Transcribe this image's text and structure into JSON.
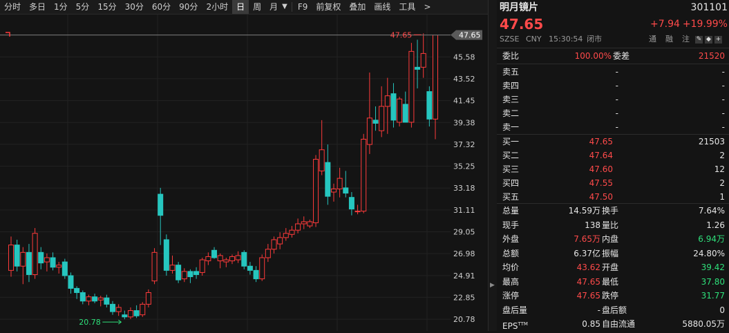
{
  "toolbar": {
    "items": [
      "分时",
      "多日",
      "1分",
      "5分",
      "15分",
      "30分",
      "60分",
      "90分",
      "2小时",
      "日",
      "周",
      "月"
    ],
    "active_index": 9,
    "f9": "F9",
    "restore": "前复权",
    "overlay": "叠加",
    "draw": "画线",
    "tools": "工具",
    "more": ">"
  },
  "chart_data": {
    "type": "candlestick",
    "ylim": [
      20.2,
      48.8
    ],
    "y_ticks": [
      "47.65",
      "45.58",
      "43.52",
      "41.45",
      "39.38",
      "37.32",
      "35.25",
      "33.18",
      "31.11",
      "29.05",
      "26.98",
      "24.91",
      "22.85",
      "20.78"
    ],
    "current_price_label": "47.65",
    "high_annotation": "47.65",
    "low_annotation": "20.78",
    "candles": [
      {
        "o": 25.4,
        "h": 28.6,
        "l": 24.8,
        "c": 27.8
      },
      {
        "o": 27.8,
        "h": 28.3,
        "l": 25.3,
        "c": 25.8
      },
      {
        "o": 25.8,
        "h": 27.6,
        "l": 24.1,
        "c": 27.1
      },
      {
        "o": 27.1,
        "h": 27.9,
        "l": 24.3,
        "c": 25.0
      },
      {
        "o": 25.0,
        "h": 29.4,
        "l": 24.6,
        "c": 28.9
      },
      {
        "o": 27.1,
        "h": 27.6,
        "l": 25.5,
        "c": 26.1
      },
      {
        "o": 26.2,
        "h": 27.0,
        "l": 25.3,
        "c": 26.6
      },
      {
        "o": 26.6,
        "h": 27.1,
        "l": 25.4,
        "c": 25.7
      },
      {
        "o": 25.7,
        "h": 26.2,
        "l": 25.1,
        "c": 25.9
      },
      {
        "o": 26.2,
        "h": 26.5,
        "l": 24.6,
        "c": 24.9
      },
      {
        "o": 24.9,
        "h": 25.2,
        "l": 23.2,
        "c": 23.7
      },
      {
        "o": 23.7,
        "h": 23.9,
        "l": 22.7,
        "c": 23.3
      },
      {
        "o": 23.3,
        "h": 23.5,
        "l": 22.2,
        "c": 22.5
      },
      {
        "o": 22.5,
        "h": 23.1,
        "l": 22.1,
        "c": 22.9
      },
      {
        "o": 22.9,
        "h": 23.2,
        "l": 22.3,
        "c": 22.5
      },
      {
        "o": 22.6,
        "h": 23.0,
        "l": 22.0,
        "c": 22.8
      },
      {
        "o": 22.8,
        "h": 23.1,
        "l": 21.9,
        "c": 22.2
      },
      {
        "o": 22.2,
        "h": 22.5,
        "l": 21.2,
        "c": 21.5
      },
      {
        "o": 21.5,
        "h": 22.2,
        "l": 21.1,
        "c": 21.9
      },
      {
        "o": 21.2,
        "h": 21.6,
        "l": 20.78,
        "c": 21.0
      },
      {
        "o": 21.0,
        "h": 21.9,
        "l": 20.8,
        "c": 21.6
      },
      {
        "o": 21.6,
        "h": 22.1,
        "l": 20.9,
        "c": 21.1
      },
      {
        "o": 21.2,
        "h": 22.4,
        "l": 21.0,
        "c": 22.2
      },
      {
        "o": 22.2,
        "h": 23.6,
        "l": 21.9,
        "c": 23.3
      },
      {
        "o": 24.4,
        "h": 27.5,
        "l": 24.1,
        "c": 27.1
      },
      {
        "o": 32.6,
        "h": 33.2,
        "l": 27.8,
        "c": 30.6
      },
      {
        "o": 28.3,
        "h": 28.8,
        "l": 24.9,
        "c": 25.4
      },
      {
        "o": 25.4,
        "h": 26.8,
        "l": 25.1,
        "c": 25.9
      },
      {
        "o": 25.9,
        "h": 26.2,
        "l": 24.2,
        "c": 24.5
      },
      {
        "o": 24.6,
        "h": 25.6,
        "l": 24.3,
        "c": 25.3
      },
      {
        "o": 25.3,
        "h": 25.5,
        "l": 24.2,
        "c": 24.8
      },
      {
        "o": 25.3,
        "h": 25.7,
        "l": 24.6,
        "c": 25.0
      },
      {
        "o": 25.2,
        "h": 26.6,
        "l": 24.9,
        "c": 26.4
      },
      {
        "o": 26.3,
        "h": 27.1,
        "l": 25.9,
        "c": 26.7
      },
      {
        "o": 27.3,
        "h": 27.6,
        "l": 26.5,
        "c": 26.6
      },
      {
        "o": 26.3,
        "h": 27.0,
        "l": 25.6,
        "c": 26.8
      },
      {
        "o": 26.2,
        "h": 26.6,
        "l": 25.7,
        "c": 26.4
      },
      {
        "o": 26.3,
        "h": 26.9,
        "l": 26.0,
        "c": 26.7
      },
      {
        "o": 26.4,
        "h": 27.2,
        "l": 26.1,
        "c": 26.8
      },
      {
        "o": 27.1,
        "h": 27.3,
        "l": 25.5,
        "c": 25.8
      },
      {
        "o": 25.8,
        "h": 26.2,
        "l": 25.0,
        "c": 25.4
      },
      {
        "o": 25.4,
        "h": 25.8,
        "l": 24.3,
        "c": 24.6
      },
      {
        "o": 24.6,
        "h": 26.9,
        "l": 24.4,
        "c": 26.6
      },
      {
        "o": 26.6,
        "h": 27.9,
        "l": 26.2,
        "c": 27.4
      },
      {
        "o": 27.4,
        "h": 28.6,
        "l": 27.0,
        "c": 28.3
      },
      {
        "o": 27.9,
        "h": 29.0,
        "l": 27.4,
        "c": 28.5
      },
      {
        "o": 28.5,
        "h": 29.4,
        "l": 28.2,
        "c": 28.9
      },
      {
        "o": 28.8,
        "h": 29.6,
        "l": 28.5,
        "c": 29.2
      },
      {
        "o": 29.2,
        "h": 30.3,
        "l": 28.9,
        "c": 29.8
      },
      {
        "o": 29.8,
        "h": 30.5,
        "l": 29.3,
        "c": 30.0
      },
      {
        "o": 29.6,
        "h": 30.2,
        "l": 29.4,
        "c": 30.0
      },
      {
        "o": 29.9,
        "h": 36.3,
        "l": 29.5,
        "c": 35.9
      },
      {
        "o": 34.8,
        "h": 39.6,
        "l": 34.4,
        "c": 36.8
      },
      {
        "o": 35.6,
        "h": 37.3,
        "l": 31.6,
        "c": 32.4
      },
      {
        "o": 32.8,
        "h": 33.6,
        "l": 31.9,
        "c": 33.1
      },
      {
        "o": 33.1,
        "h": 35.1,
        "l": 32.3,
        "c": 34.1
      },
      {
        "o": 33.2,
        "h": 34.8,
        "l": 32.3,
        "c": 32.7
      },
      {
        "o": 32.3,
        "h": 32.8,
        "l": 30.6,
        "c": 31.2
      },
      {
        "o": 31.0,
        "h": 31.6,
        "l": 30.7,
        "c": 31.0
      },
      {
        "o": 31.0,
        "h": 38.3,
        "l": 30.8,
        "c": 37.8
      },
      {
        "o": 37.3,
        "h": 44.1,
        "l": 36.4,
        "c": 39.8
      },
      {
        "o": 39.6,
        "h": 40.9,
        "l": 38.6,
        "c": 39.3
      },
      {
        "o": 38.6,
        "h": 42.8,
        "l": 38.0,
        "c": 40.9
      },
      {
        "o": 40.9,
        "h": 43.6,
        "l": 38.3,
        "c": 41.9
      },
      {
        "o": 42.1,
        "h": 43.1,
        "l": 38.9,
        "c": 39.6
      },
      {
        "o": 39.4,
        "h": 41.8,
        "l": 39.0,
        "c": 41.6
      },
      {
        "o": 41.1,
        "h": 42.3,
        "l": 39.6,
        "c": 39.4
      },
      {
        "o": 39.4,
        "h": 46.9,
        "l": 38.9,
        "c": 46.1
      },
      {
        "o": 44.6,
        "h": 47.2,
        "l": 42.6,
        "c": 44.4
      },
      {
        "o": 44.6,
        "h": 47.8,
        "l": 43.6,
        "c": 45.9
      },
      {
        "o": 42.3,
        "h": 42.8,
        "l": 39.0,
        "c": 39.7
      },
      {
        "o": 39.7,
        "h": 47.65,
        "l": 37.8,
        "c": 47.65
      }
    ]
  },
  "quote": {
    "name": "明月镜片",
    "code": "301101",
    "price": "47.65",
    "change": "+7.94",
    "change_pct": "+19.99%",
    "exchange": "SZSE",
    "currency": "CNY",
    "time": "15:30:54",
    "status": "闭市",
    "tag1": "通",
    "tag2": "融",
    "tag3": "注",
    "webi_label": "委比",
    "webi": "100.00%",
    "weicha_label": "委差",
    "weicha": "21520",
    "asks": [
      {
        "label": "卖五",
        "price": "-",
        "vol": "-"
      },
      {
        "label": "卖四",
        "price": "-",
        "vol": "-"
      },
      {
        "label": "卖三",
        "price": "-",
        "vol": "-"
      },
      {
        "label": "卖二",
        "price": "-",
        "vol": "-"
      },
      {
        "label": "卖一",
        "price": "-",
        "vol": "-"
      }
    ],
    "bids": [
      {
        "label": "买一",
        "price": "47.65",
        "vol": "21503"
      },
      {
        "label": "买二",
        "price": "47.64",
        "vol": "2"
      },
      {
        "label": "买三",
        "price": "47.60",
        "vol": "12"
      },
      {
        "label": "买四",
        "price": "47.55",
        "vol": "2"
      },
      {
        "label": "买五",
        "price": "47.50",
        "vol": "1"
      }
    ],
    "stats": [
      {
        "l1": "总量",
        "v1": "14.59万",
        "c1": "white",
        "l2": "换手",
        "v2": "7.64%",
        "c2": "white"
      },
      {
        "l1": "现手",
        "v1": "138",
        "c1": "white",
        "l2": "量比",
        "v2": "1.26",
        "c2": "white"
      },
      {
        "l1": "外盘",
        "v1": "7.65万",
        "c1": "red",
        "l2": "内盘",
        "v2": "6.94万",
        "c2": "green"
      },
      {
        "l1": "总额",
        "v1": "6.37亿",
        "c1": "white",
        "l2": "振幅",
        "v2": "24.80%",
        "c2": "white"
      },
      {
        "l1": "均价",
        "v1": "43.62",
        "c1": "red",
        "l2": "开盘",
        "v2": "39.42",
        "c2": "green"
      },
      {
        "l1": "最高",
        "v1": "47.65",
        "c1": "red",
        "l2": "最低",
        "v2": "37.80",
        "c2": "green"
      },
      {
        "l1": "涨停",
        "v1": "47.65",
        "c1": "red",
        "l2": "跌停",
        "v2": "31.77",
        "c2": "green"
      },
      {
        "l1": "盘后量",
        "v1": "-",
        "c1": "white",
        "l2": "盘后额",
        "v2": "0",
        "c2": "white"
      },
      {
        "l1": "EPS",
        "v1": "0.85",
        "c1": "white",
        "l2": "自由流通",
        "v2": "5880.05万",
        "c2": "white"
      }
    ],
    "eps_sup": "TTM"
  },
  "colors": {
    "up": "#ff3b3b",
    "down": "#26c6bf",
    "bg": "#141414"
  }
}
